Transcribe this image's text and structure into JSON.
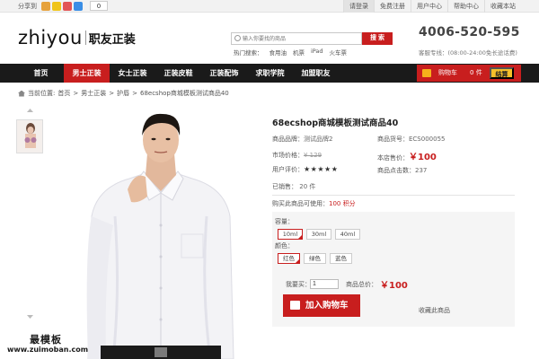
{
  "topbar": {
    "share_label": "分享到",
    "share_count": "0",
    "share_icons": [
      {
        "name": "sina-weibo-icon",
        "color": "#e6a23c"
      },
      {
        "name": "qzone-icon",
        "color": "#f0c419"
      },
      {
        "name": "renren-icon",
        "color": "#e25555"
      },
      {
        "name": "tencent-weibo-icon",
        "color": "#3a8ee6"
      }
    ],
    "links": [
      "请登录",
      "免费注册",
      "用户中心",
      "帮助中心",
      "收藏本站"
    ]
  },
  "header": {
    "logo_text": "zhiyou",
    "logo_cn": "职友正装",
    "search_placeholder": "输入你要找的商品",
    "search_button": "搜 索",
    "hot_label": "热门搜索：",
    "hot_terms": [
      "食用油",
      "机票",
      "iPad",
      "火车票"
    ],
    "hotline": "4006-520-595",
    "hotline_hours": "客服专线：(08:00-24:00免长途话费)"
  },
  "nav": {
    "items": [
      "首页",
      "男士正装",
      "女士正装",
      "正装皮鞋",
      "正装配饰",
      "求职学院",
      "加盟职友"
    ],
    "active_index": 1
  },
  "cart": {
    "label": "购物车",
    "count": "0",
    "unit": "件",
    "checkout": "结算"
  },
  "breadcrumb": {
    "prefix": "当前位置:",
    "items": [
      "首页",
      ">",
      "男士正装",
      ">",
      "护唇",
      ">",
      "68ecshop商城模板测试商品40"
    ]
  },
  "product": {
    "title": "68ecshop商城模板测试商品40",
    "brand_label": "商品品牌：",
    "brand": "测试品牌2",
    "sku_label": "商品货号：",
    "sku": "ECS000055",
    "market_price_label": "市场价格：",
    "market_price": "¥ 129",
    "shop_price_label": "本店售价：",
    "shop_price": "￥100",
    "rating_label": "用户评价：",
    "rating_stars": "★★★★★",
    "rating_value": 5,
    "clicks_label": "商品点击数：",
    "clicks": "237",
    "sold_label": "已销售：",
    "sold": "20 件",
    "points_label": "购买此商品可使用：",
    "points": "100 积分"
  },
  "options": {
    "capacity_label": "容量：",
    "capacity": [
      "10ml",
      "30ml",
      "40ml"
    ],
    "capacity_selected": 0,
    "color_label": "颜色：",
    "colors": [
      "红色",
      "绿色",
      "蓝色"
    ],
    "color_selected": 0,
    "qty_label": "我要买：",
    "qty_value": "1",
    "total_label": "商品总价：",
    "total_price": "￥100",
    "add_to_cart": "加入购物车",
    "favorite": "收藏此商品"
  },
  "watermark": {
    "line1": "最模板",
    "line2": "www.zuimoban.com"
  },
  "colors": {
    "brand_red": "#c81e1e",
    "nav_black": "#1a1a1a",
    "checkout_yellow": "#f6c02a",
    "panel_gray": "#f5f5f5"
  }
}
